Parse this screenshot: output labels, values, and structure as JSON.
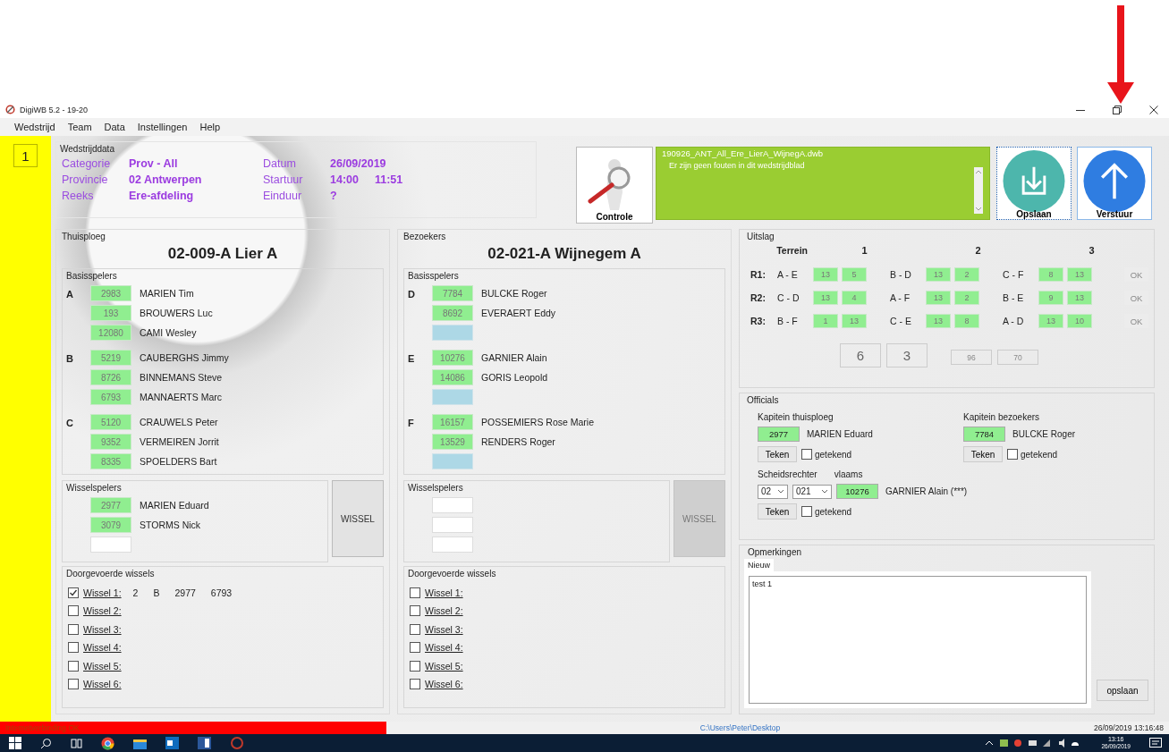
{
  "window": {
    "title": "DigiWB 5.2 - 19-20"
  },
  "menu": [
    "Wedstrijd",
    "Team",
    "Data",
    "Instellingen",
    "Help"
  ],
  "page_number": "1",
  "match_data": {
    "title": "Wedstrijddata",
    "fields": [
      {
        "label": "Categorie",
        "values": [
          "Prov - All"
        ]
      },
      {
        "label": "Datum",
        "values": [
          "26/09/2019"
        ]
      },
      {
        "label": "Provincie",
        "values": [
          "02 Antwerpen"
        ]
      },
      {
        "label": "Startuur",
        "values": [
          "14:00",
          "11:51"
        ]
      },
      {
        "label": "Reeks",
        "values": [
          "Ere-afdeling"
        ]
      },
      {
        "label": "Einduur",
        "values": [
          "?"
        ]
      }
    ]
  },
  "check_button": {
    "label": "Controle"
  },
  "message_panel": {
    "file": "190926_ANT_All_Ere_LierA_WijnegA.dwb",
    "text": "Er zijn geen fouten in dit wedstrijdblad"
  },
  "actions": [
    {
      "label": "Opslaan",
      "kind": "save"
    },
    {
      "label": "Verstuur",
      "kind": "send"
    }
  ],
  "teams": [
    {
      "section": "Thuisploeg",
      "name": "02-009-A Lier A",
      "base_title": "Basisspelers",
      "groups": [
        {
          "letter": "A",
          "players": [
            {
              "kind": "player",
              "number": "2983",
              "name": "MARIEN Tim"
            },
            {
              "kind": "player",
              "number": "193",
              "name": "BROUWERS Luc"
            },
            {
              "kind": "player",
              "number": "12080",
              "name": "CAMI Wesley"
            }
          ]
        },
        {
          "letter": "B",
          "players": [
            {
              "kind": "player",
              "number": "5219",
              "name": "CAUBERGHS Jimmy"
            },
            {
              "kind": "player",
              "number": "8726",
              "name": "BINNEMANS Steve"
            },
            {
              "kind": "player",
              "number": "6793",
              "name": "MANNAERTS Marc"
            }
          ]
        },
        {
          "letter": "C",
          "players": [
            {
              "kind": "player",
              "number": "5120",
              "name": "CRAUWELS Peter"
            },
            {
              "kind": "player",
              "number": "9352",
              "name": "VERMEIREN Jorrit"
            },
            {
              "kind": "player",
              "number": "8335",
              "name": "SPOELDERS Bart"
            }
          ]
        }
      ],
      "subs_title": "Wisselspelers",
      "subs": [
        {
          "kind": "player",
          "number": "2977",
          "name": "MARIEN Eduard"
        },
        {
          "kind": "player",
          "number": "3079",
          "name": "STORMS Nick"
        },
        {
          "kind": "blank"
        }
      ],
      "wissel_button": {
        "label": "WISSEL",
        "disabled": false
      },
      "done_title": "Doorgevoerde wissels",
      "done": [
        {
          "label": "Wissel 1:",
          "checked": true,
          "details": [
            "2",
            "B",
            "2977",
            "6793"
          ]
        },
        {
          "label": "Wissel 2:",
          "checked": false
        },
        {
          "label": "Wissel 3:",
          "checked": false
        },
        {
          "label": "Wissel 4:",
          "checked": false
        },
        {
          "label": "Wissel 5:",
          "checked": false
        },
        {
          "label": "Wissel 6:",
          "checked": false
        }
      ]
    },
    {
      "section": "Bezoekers",
      "name": "02-021-A Wijnegem A",
      "base_title": "Basisspelers",
      "groups": [
        {
          "letter": "D",
          "players": [
            {
              "kind": "player",
              "number": "7784",
              "name": "BULCKE Roger"
            },
            {
              "kind": "player",
              "number": "8692",
              "name": "EVERAERT Eddy"
            },
            {
              "kind": "open"
            }
          ]
        },
        {
          "letter": "E",
          "players": [
            {
              "kind": "player",
              "number": "10276",
              "name": "GARNIER Alain"
            },
            {
              "kind": "player",
              "number": "14086",
              "name": "GORIS Leopold"
            },
            {
              "kind": "open"
            }
          ]
        },
        {
          "letter": "F",
          "players": [
            {
              "kind": "player",
              "number": "16157",
              "name": "POSSEMIERS Rose Marie"
            },
            {
              "kind": "player",
              "number": "13529",
              "name": "RENDERS Roger"
            },
            {
              "kind": "open"
            }
          ]
        }
      ],
      "subs_title": "Wisselspelers",
      "subs": [
        {
          "kind": "blank"
        },
        {
          "kind": "blank"
        },
        {
          "kind": "blank"
        }
      ],
      "wissel_button": {
        "label": "WISSEL",
        "disabled": true
      },
      "done_title": "Doorgevoerde wissels",
      "done": [
        {
          "label": "Wissel 1:",
          "checked": false
        },
        {
          "label": "Wissel 2:",
          "checked": false
        },
        {
          "label": "Wissel 3:",
          "checked": false
        },
        {
          "label": "Wissel 4:",
          "checked": false
        },
        {
          "label": "Wissel 5:",
          "checked": false
        },
        {
          "label": "Wissel 6:",
          "checked": false
        }
      ]
    }
  ],
  "result": {
    "title": "Uitslag",
    "header_label": "Terrein",
    "courts": [
      "1",
      "2",
      "3"
    ],
    "rounds": [
      {
        "label": "R1:",
        "games": [
          {
            "pair": "A - E",
            "scores": [
              "13",
              "5"
            ]
          },
          {
            "pair": "B - D",
            "scores": [
              "13",
              "2"
            ]
          },
          {
            "pair": "C - F",
            "scores": [
              "8",
              "13"
            ]
          }
        ],
        "ok": "OK"
      },
      {
        "label": "R2:",
        "games": [
          {
            "pair": "C - D",
            "scores": [
              "13",
              "4"
            ]
          },
          {
            "pair": "A - F",
            "scores": [
              "13",
              "2"
            ]
          },
          {
            "pair": "B - E",
            "scores": [
              "9",
              "13"
            ]
          }
        ],
        "ok": "OK"
      },
      {
        "label": "R3:",
        "games": [
          {
            "pair": "B - F",
            "scores": [
              "1",
              "13"
            ]
          },
          {
            "pair": "C - E",
            "scores": [
              "13",
              "8"
            ]
          },
          {
            "pair": "A - D",
            "scores": [
              "13",
              "10"
            ]
          }
        ],
        "ok": "OK"
      }
    ],
    "totals": [
      "6",
      "3"
    ],
    "points": [
      "96",
      "70"
    ]
  },
  "officials": {
    "title": "Officials",
    "captains": [
      {
        "label": "Kapitein thuisploeg",
        "number": "2977",
        "name": "MARIEN Eduard",
        "button": "Teken",
        "signed_label": "getekend",
        "signed": false
      },
      {
        "label": "Kapitein bezoekers",
        "number": "7784",
        "name": "BULCKE Roger",
        "button": "Teken",
        "signed_label": "getekend",
        "signed": false
      }
    ],
    "referee": {
      "label": "Scheidsrechter",
      "language": "vlaams",
      "province": "02",
      "club": "021",
      "number": "10276",
      "name": "GARNIER Alain (***)",
      "button": "Teken",
      "signed_label": "getekend",
      "signed": false
    }
  },
  "remarks": {
    "title": "Opmerkingen",
    "tabs": [
      {
        "label": "Nieuw",
        "selected": true
      }
    ],
    "text": "test 1",
    "button": "opslaan"
  },
  "status_bar": {
    "connection": "Internetverbinding OK",
    "path": "C:\\Users\\Peter\\Desktop",
    "datetime": "26/09/2019 13:16:48"
  },
  "taskbar": {
    "time": "13:16",
    "date": "26/09/2019"
  }
}
